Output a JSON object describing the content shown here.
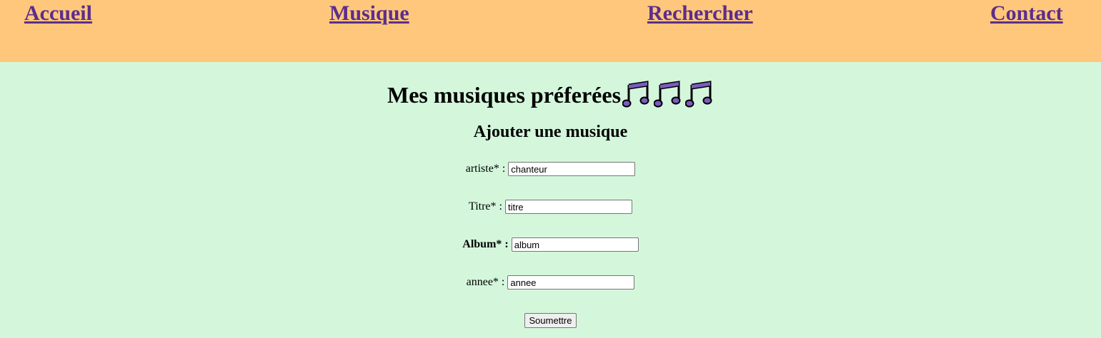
{
  "nav": {
    "items": [
      {
        "label": "Accueil"
      },
      {
        "label": "Musique"
      },
      {
        "label": "Rechercher"
      },
      {
        "label": "Contact"
      }
    ]
  },
  "header": {
    "title": "Mes musiques préferées",
    "icons": [
      "music-note-icon",
      "music-note-icon",
      "music-note-icon"
    ]
  },
  "form": {
    "heading": "Ajouter une musique",
    "fields": [
      {
        "label": "artiste* :",
        "value": "chanteur"
      },
      {
        "label": "Titre* :",
        "value": "titre"
      },
      {
        "label": "Album* :",
        "value": "album"
      },
      {
        "label": "annee* :",
        "value": "annee"
      }
    ],
    "submit_label": "Soumettre"
  },
  "colors": {
    "nav_background": "#ffc77b",
    "page_background": "#d4f7dc",
    "link": "#5c2d8c",
    "note_fill": "#7a5cc0"
  }
}
